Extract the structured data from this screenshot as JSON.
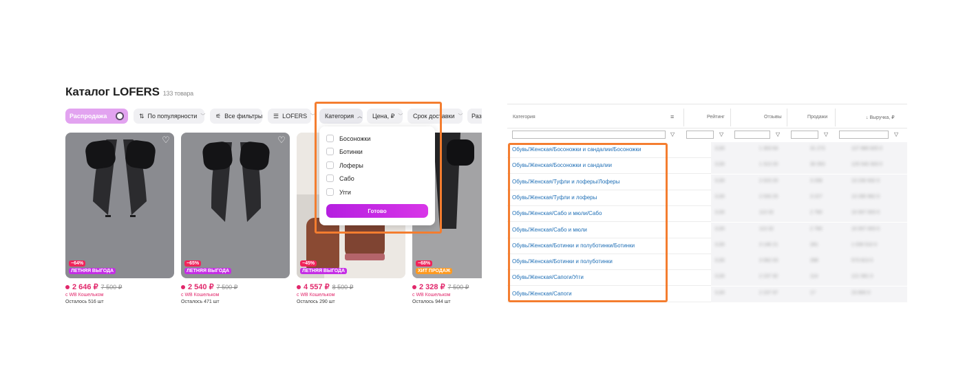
{
  "catalog": {
    "title": "Каталог LOFERS",
    "count": "133 товара",
    "filters": [
      {
        "label": "Распродажа",
        "icon": "toggle-icon"
      },
      {
        "label": "По популярности",
        "icon": "sort-icon"
      },
      {
        "label": "Все фильтры",
        "icon": "sliders-icon"
      },
      {
        "label": "LOFERS",
        "icon": "menu-icon"
      },
      {
        "label": "Категория",
        "icon": "chevron-up-icon"
      },
      {
        "label": "Цена, ₽",
        "icon": "chevron-down-icon"
      },
      {
        "label": "Срок доставки",
        "icon": "chevron-down-icon"
      },
      {
        "label": "Раз",
        "icon": ""
      }
    ],
    "dropdown": {
      "options": [
        "Босоножки",
        "Ботинки",
        "Лоферы",
        "Сабо",
        "Угги"
      ],
      "button": "Готово"
    },
    "products": [
      {
        "discount": "−64%",
        "promo": "ЛЕТНЯЯ ВЫГОДА",
        "price": "2 646 ₽",
        "old_price": "7 500 ₽",
        "wallet": "с WB Кошельком",
        "stock": "Осталось 516 шт"
      },
      {
        "discount": "−65%",
        "promo": "ЛЕТНЯЯ ВЫГОДА",
        "price": "2 540 ₽",
        "old_price": "7 500 ₽",
        "wallet": "с WB Кошельком",
        "stock": "Осталось 471 шт"
      },
      {
        "discount": "−45%",
        "promo": "ЛЕТНЯЯ ВЫГОДА",
        "price": "4 557 ₽",
        "old_price": "8 500 ₽",
        "wallet": "с WB Кошельком",
        "stock": "Осталось 290 шт"
      },
      {
        "discount": "−68%",
        "promo": "ХИТ ПРОДАЖ",
        "price": "2 328 ₽",
        "old_price": "7 500 ₽",
        "wallet": "с WB Кошельком",
        "stock": "Осталось 944 шт"
      }
    ]
  },
  "analytics": {
    "columns": [
      "Категория",
      "Рейтинг",
      "Отзывы",
      "Продажи",
      "↓ Выручка, ₽"
    ],
    "rows": [
      {
        "category": "Обувь/Женская/Босоножки и сандалии/Босоножки",
        "rating": "0,00",
        "reviews": "1 303 64",
        "sales": "31 273",
        "revenue": "127 880 825 0"
      },
      {
        "category": "Обувь/Женская/Босоножки и сандалии",
        "rating": "0,00",
        "reviews": "1 313 20",
        "sales": "30 353",
        "revenue": "125 540 303 0"
      },
      {
        "category": "Обувь/Женская/Туфли и лоферы/Лоферы",
        "rating": "0,00",
        "reviews": "2 023 20",
        "sales": "3 208",
        "revenue": "13 230 932 0"
      },
      {
        "category": "Обувь/Женская/Туфли и лоферы",
        "rating": "0,00",
        "reviews": "2 033 25",
        "sales": "3 227",
        "revenue": "13 280 962 0"
      },
      {
        "category": "Обувь/Женская/Сабо и мюли/Сабо",
        "rating": "0,00",
        "reviews": "113 32",
        "sales": "2 760",
        "revenue": "10 007 003 0"
      },
      {
        "category": "Обувь/Женская/Сабо и мюли",
        "rating": "0,00",
        "reviews": "113 32",
        "sales": "2 760",
        "revenue": "10 007 003 0"
      },
      {
        "category": "Обувь/Женская/Ботинки и полуботинки/Ботинки",
        "rating": "0,00",
        "reviews": "3 146 21",
        "sales": "281",
        "revenue": "1 039 510 0"
      },
      {
        "category": "Обувь/Женская/Ботинки и полуботинки",
        "rating": "0,00",
        "reviews": "3 062 03",
        "sales": "288",
        "revenue": "573 813 0"
      },
      {
        "category": "Обувь/Женская/Сапоги/Угги",
        "rating": "0,00",
        "reviews": "2 237 92",
        "sales": "114",
        "revenue": "121 581 0"
      },
      {
        "category": "Обувь/Женская/Сапоги",
        "rating": "0,00",
        "reviews": "2 237 97",
        "sales": "17",
        "revenue": "23 800 0"
      }
    ]
  },
  "colors": {
    "highlight": "#f47d2f",
    "accent": "#c52de6",
    "price": "#e1276b",
    "link": "#1f6fb6"
  }
}
